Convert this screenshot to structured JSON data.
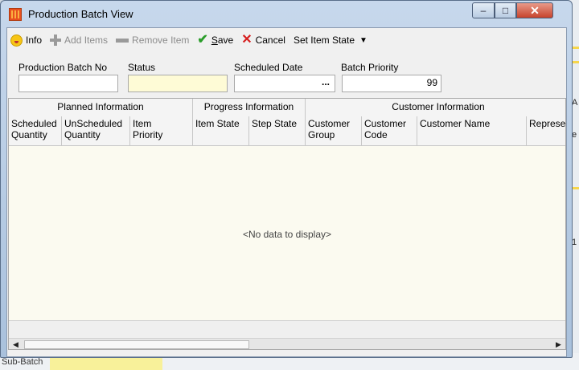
{
  "window": {
    "title": "Production Batch View",
    "controls": {
      "minimize": "–",
      "maximize": "□",
      "close": "✕"
    }
  },
  "toolbar": {
    "info_label": "Info",
    "add_items_label": "Add Items",
    "remove_item_label": "Remove Item",
    "save_label_mnemonic": "S",
    "save_label_rest": "ave",
    "cancel_label": "Cancel",
    "set_item_state_label": "Set Item State",
    "icons": [
      "smiley-info-icon",
      "plus-icon",
      "minus-icon",
      "checkmark-icon",
      "x-icon",
      "dropdown-caret-icon"
    ]
  },
  "fields": {
    "batch_no": {
      "label": "Production Batch No",
      "value": ""
    },
    "status": {
      "label": "Status",
      "value": ""
    },
    "scheduled_date": {
      "label": "Scheduled Date",
      "value": "",
      "button": "..."
    },
    "batch_priority": {
      "label": "Batch Priority",
      "value": "99"
    }
  },
  "grid": {
    "bands": [
      "Planned Information",
      "Progress Information",
      "Customer Information"
    ],
    "columns": [
      "Scheduled\nQuantity",
      "UnScheduled\nQuantity",
      "Item\nPriority",
      "Item State",
      "Step State",
      "Customer\nGroup",
      "Customer\nCode",
      "Customer Name",
      "Represe"
    ],
    "empty_text": "<No data to display>",
    "scroll_left": "◀",
    "scroll_right": "▶"
  },
  "background": {
    "bottom_label": "Sub-Batch",
    "right_fragments": [
      "A",
      "e",
      "1"
    ]
  },
  "colors": {
    "status_field": "#fefbd6",
    "grid_background": "#fbfaf0",
    "save_icon": "#2a9d2a",
    "cancel_icon": "#d61f1f",
    "close_button": "#c7432c"
  }
}
